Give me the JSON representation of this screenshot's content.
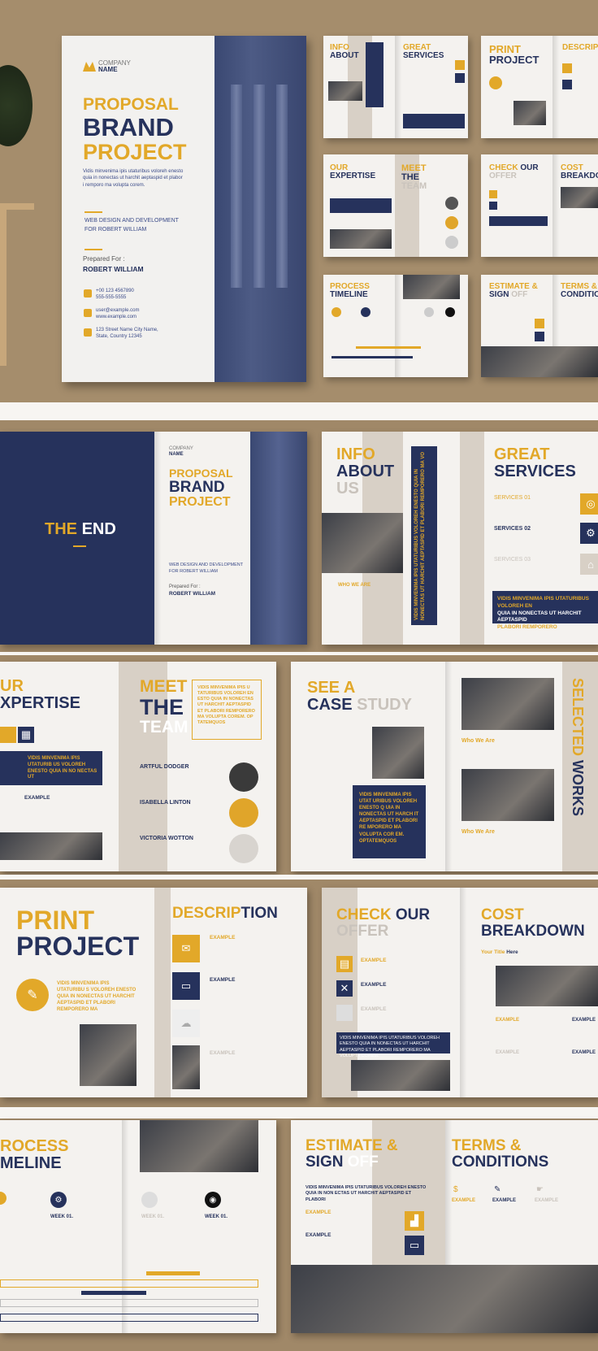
{
  "cover": {
    "company_line1": "COMPANY",
    "company_line2": "NAME",
    "title_line1": "PROPOSAL",
    "title_line2": "BRAND",
    "title_line3": "PROJECT",
    "intro_line1": "Vidis minvenima ipis utaturibus voloreh enesto",
    "intro_line2": "quia in nonectas ut harchit aeptaspid et plabor",
    "intro_line3": "i remporo ma volupta corem.",
    "subtitle_line1": "WEB DESIGN AND DEVELOPMENT",
    "subtitle_line2": "FOR ROBERT WILLIAM",
    "prepared_label": "Prepared For :",
    "prepared_name": "ROBERT WILLIAM",
    "phone1": "+00 123 4567890",
    "phone2": "555-555-5555",
    "email1": "user@example.com",
    "email2": "www.example.com",
    "address1": "123 Street Name City Name,",
    "address2": "State, Country 12345"
  },
  "thumbs": {
    "t1a": "INFO",
    "t1b": "ABOUT",
    "t2a": "GREAT",
    "t2b": "SERVICES",
    "t3a": "PRINT",
    "t3b": "PROJECT",
    "t4a": "DESCRIP",
    "t5a": "OUR",
    "t5b": "EXPERTISE",
    "t6a": "MEET",
    "t6b": "THE",
    "t6c": "TEAM",
    "t7a": "CHECK",
    "t7b": "OUR",
    "t7c": "OFFER",
    "t8a": "COST",
    "t8b": "BREAKDOW",
    "t9a": "PROCESS",
    "t9b": "TIMELINE",
    "t10a": "ESTIMATE &",
    "t10b": "SIGN",
    "t10c": "OFF",
    "t11a": "TERMS &",
    "t11b": "CONDITION"
  },
  "end_spread": {
    "the": "THE",
    "end": "END",
    "company_line1": "COMPANY",
    "company_line2": "NAME",
    "title_line1": "PROPOSAL",
    "title_line2": "BRAND",
    "title_line3": "PROJECT",
    "sub1": "WEB DESIGN AND DEVELOPMENT",
    "sub2": "FOR ROBERT WILLIAM",
    "prepared_label": "Prepared For :",
    "prepared_name": "ROBERT WILLIAM"
  },
  "info_spread": {
    "info": "INFO",
    "about": "ABOUT",
    "us": "US",
    "who_we_are": "WHO WE ARE",
    "vertical_text": "VIDIS MINVENIMA IPIS UTATURIBUS VOLOREH ENESTO QUIA IN NONECTAS UT HARCHIT AEPTASPID ET PLABORI REMPORERO MA VO",
    "great": "GREAT",
    "services": "SERVICES",
    "s1": "SERVICES 01",
    "s2": "SERVICES 02",
    "s3": "SERVICES 03",
    "box_line1": "VIDIS MINVENIMA IPIS UTATURIBUS VOLOREH EN",
    "box_line2": "QUIA IN NONECTAS UT HARCHIT AEPTASPID",
    "box_line3": "PLABORI REMPORERO"
  },
  "expertise_spread": {
    "ur": "UR",
    "expertise": "XPERTISE",
    "box_text": "VIDIS MINVENIMA IPIS UTATURIB US VOLOREH ENESTO QUIA IN NO NECTAS UT",
    "example": "EXAMPLE",
    "meet": "MEET",
    "the": "THE",
    "team": "TEAM",
    "quote": "VIDIS MINVENIMA IPIS U TATURIBUS VOLOREH EN ESTO QUIA IN NONECTAS UT HARCHIT AEPTASPID ET PLABORI REMPORERO MA VOLUPTA COREM. OP TATEMQUOS",
    "m1": "ARTFUL DODGER",
    "m2": "ISABELLA LINTON",
    "m3": "VICTORIA WOTTON"
  },
  "case_spread": {
    "see_a": "SEE A",
    "case": "CASE",
    "study": "STUDY",
    "box_text": "VIDIS MINVENIMA IPIS UTAT URIBUS VOLOREH ENESTO Q UIA IN NONECTAS UT HARCH IT AEPTASPID ET PLABORI RE MPORERO MA VOLUPTA COR EM. OPTATEMQUOS",
    "who1": "Who We Are",
    "who2": "Who We Are",
    "selected": "SELECTED",
    "works": "WORKS"
  },
  "print_spread": {
    "print": "PRINT",
    "project": "PROJECT",
    "quote": "VIDIS MINVENIMA IPIS UTATURIBU S VOLOREH ENESTO QUIA IN NONECTAS UT HARCHIT AEPTASPID ET PLABORI REMPORERO MA",
    "descrip": "DESCRIP",
    "tion": "TION",
    "e1": "EXAMPLE",
    "e2": "EXAMPLE",
    "e3": "EXAMPLE"
  },
  "offer_spread": {
    "check": "CHECK",
    "our": "OUR",
    "offer": "OFFER",
    "e1": "EXAMPLE",
    "e2": "EXAMPLE",
    "e3": "EXAMPLE",
    "box_text": "VIDIS MINVENIMA IPIS UTATURIBUS VOLOREH ENESTO QUIA IN NONECTAS UT HARCHIT AEPTASPID ET PLABORI REMPORERO MA VOLUPTA COREM.",
    "cost": "COST",
    "breakdown": "BREAKDOWN",
    "your_title": "Your Title",
    "here": "Here",
    "c1": "EXAMPLE",
    "c2": "EXAMPLE",
    "c3": "EXAMPLE",
    "c4": "EXAMPLE"
  },
  "process_spread": {
    "rocess": "ROCESS",
    "meline": "MELINE",
    "w1": "WEEK 01.",
    "w2": "WEEK 01.",
    "w3": "WEEK 01."
  },
  "estimate_spread": {
    "estimate": "ESTIMATE &",
    "sign": "SIGN",
    "off": "OFF",
    "intro": "VIDIS MINVENIMA IPIS UTATURIBUS VOLOREH ENESTO QUIA IN NON ECTAS UT HARCHIT AEPTASPID ET PLABORI",
    "e1": "EXAMPLE",
    "e2": "EXAMPLE",
    "terms": "TERMS &",
    "conditions": "CONDITIONS",
    "t1": "EXAMPLE",
    "t2": "EXAMPLE",
    "t3": "EXAMPLE"
  }
}
